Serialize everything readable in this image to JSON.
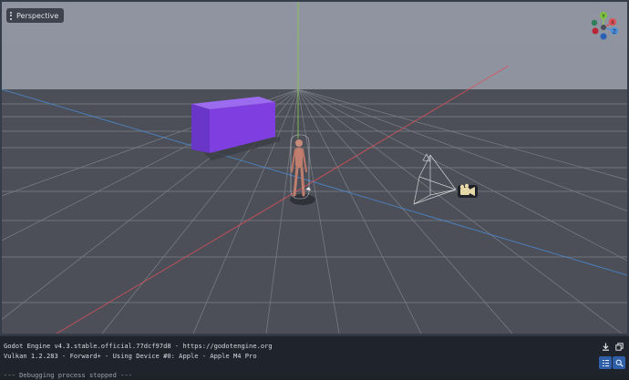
{
  "viewport": {
    "mode_label": "Perspective",
    "gizmo_axes": [
      "Y",
      "X",
      "Z"
    ],
    "colors": {
      "background": "#8a8f9a",
      "floor": "#4c4f58",
      "box": "#7f3fe0",
      "x_axis": "#e0505a",
      "y_axis": "#8ad04a",
      "z_axis": "#4a90e0"
    }
  },
  "output": {
    "lines": [
      "Godot Engine v4.3.stable.official.77dcf97d8 - https://godotengine.org",
      "Vulkan 1.2.283 - Forward+ - Using Device #0: Apple - Apple M4 Pro",
      ""
    ],
    "stopped_message": "--- Debugging process stopped ---"
  },
  "toolbar": {
    "icons": [
      "download-icon",
      "copy-icon",
      "filter-list-icon",
      "search-icon"
    ]
  }
}
